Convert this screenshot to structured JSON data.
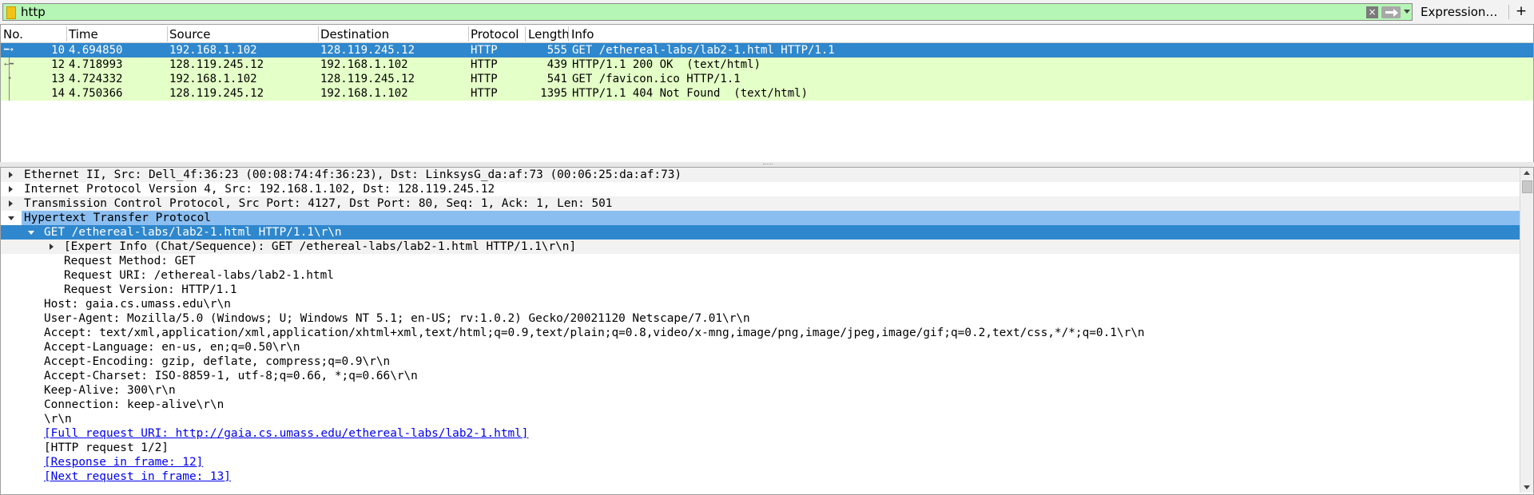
{
  "filter": {
    "value": "http",
    "expression_label": "Expression…",
    "add_label": "+",
    "clear_label": "×"
  },
  "packet_list": {
    "columns": [
      "No.",
      "Time",
      "Source",
      "Destination",
      "Protocol",
      "Length",
      "Info"
    ],
    "rows": [
      {
        "no": "10",
        "time": "4.694850",
        "src": "192.168.1.102",
        "dst": "128.119.245.12",
        "proto": "HTTP",
        "len": "555",
        "info": "GET /ethereal-labs/lab2-1.html HTTP/1.1",
        "selected": true
      },
      {
        "no": "12",
        "time": "4.718993",
        "src": "128.119.245.12",
        "dst": "192.168.1.102",
        "proto": "HTTP",
        "len": "439",
        "info": "HTTP/1.1 200 OK  (text/html)",
        "selected": false
      },
      {
        "no": "13",
        "time": "4.724332",
        "src": "192.168.1.102",
        "dst": "128.119.245.12",
        "proto": "HTTP",
        "len": "541",
        "info": "GET /favicon.ico HTTP/1.1",
        "selected": false
      },
      {
        "no": "14",
        "time": "4.750366",
        "src": "128.119.245.12",
        "dst": "192.168.1.102",
        "proto": "HTTP",
        "len": "1395",
        "info": "HTTP/1.1 404 Not Found  (text/html)",
        "selected": false
      }
    ]
  },
  "details": {
    "ethernet": "Ethernet II, Src: Dell_4f:36:23 (00:08:74:4f:36:23), Dst: LinksysG_da:af:73 (00:06:25:da:af:73)",
    "ip": "Internet Protocol Version 4, Src: 192.168.1.102, Dst: 128.119.245.12",
    "tcp": "Transmission Control Protocol, Src Port: 4127, Dst Port: 80, Seq: 1, Ack: 1, Len: 501",
    "http": "Hypertext Transfer Protocol",
    "request_line": "GET /ethereal-labs/lab2-1.html HTTP/1.1\\r\\n",
    "expert_info": "[Expert Info (Chat/Sequence): GET /ethereal-labs/lab2-1.html HTTP/1.1\\r\\n]",
    "request_method": "Request Method: GET",
    "request_uri": "Request URI: /ethereal-labs/lab2-1.html",
    "request_version": "Request Version: HTTP/1.1",
    "host": "Host: gaia.cs.umass.edu\\r\\n",
    "user_agent": "User-Agent: Mozilla/5.0 (Windows; U; Windows NT 5.1; en-US; rv:1.0.2) Gecko/20021120 Netscape/7.01\\r\\n",
    "accept": "Accept: text/xml,application/xml,application/xhtml+xml,text/html;q=0.9,text/plain;q=0.8,video/x-mng,image/png,image/jpeg,image/gif;q=0.2,text/css,*/*;q=0.1\\r\\n",
    "accept_language": "Accept-Language: en-us, en;q=0.50\\r\\n",
    "accept_encoding": "Accept-Encoding: gzip, deflate, compress;q=0.9\\r\\n",
    "accept_charset": "Accept-Charset: ISO-8859-1, utf-8;q=0.66, *;q=0.66\\r\\n",
    "keep_alive": "Keep-Alive: 300\\r\\n",
    "connection": "Connection: keep-alive\\r\\n",
    "crlf": "\\r\\n",
    "full_uri": "[Full request URI: http://gaia.cs.umass.edu/ethereal-labs/lab2-1.html]",
    "http_request": "[HTTP request 1/2]",
    "response_in": "[Response in frame: 12]",
    "next_request_in": "[Next request in frame: 13]"
  },
  "colors": {
    "filter_valid": "#b5f5b5",
    "row_http": "#e4ffc7",
    "selection": "#2f87cd",
    "selection_light": "#8bbef0",
    "link": "#0000ee"
  }
}
